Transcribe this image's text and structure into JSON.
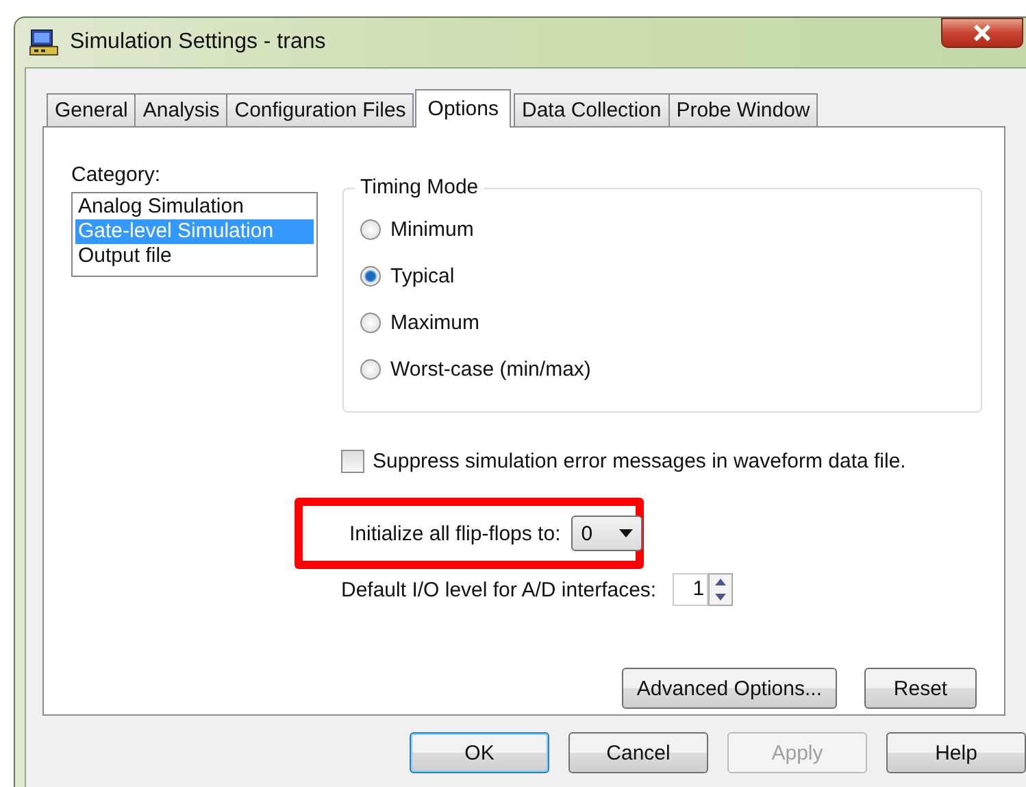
{
  "window": {
    "title": "Simulation Settings - trans"
  },
  "tabs": [
    {
      "label": "General",
      "selected": false
    },
    {
      "label": "Analysis",
      "selected": false
    },
    {
      "label": "Configuration Files",
      "selected": false
    },
    {
      "label": "Options",
      "selected": true
    },
    {
      "label": "Data Collection",
      "selected": false
    },
    {
      "label": "Probe Window",
      "selected": false
    }
  ],
  "category": {
    "label": "Category:",
    "items": [
      {
        "label": "Analog Simulation",
        "selected": false
      },
      {
        "label": "Gate-level Simulation",
        "selected": true
      },
      {
        "label": "Output file",
        "selected": false
      }
    ]
  },
  "timing_mode": {
    "title": "Timing Mode",
    "options": [
      {
        "label": "Minimum",
        "selected": false
      },
      {
        "label": "Typical",
        "selected": true
      },
      {
        "label": "Maximum",
        "selected": false
      },
      {
        "label": "Worst-case (min/max)",
        "selected": false
      }
    ]
  },
  "suppress_errors": {
    "label": "Suppress simulation error messages in waveform data file.",
    "checked": false
  },
  "init_flipflops": {
    "label": "Initialize all flip-flops to:",
    "value": "0",
    "highlighted": true
  },
  "default_io_level": {
    "label": "Default I/O level for A/D interfaces:",
    "value": "1"
  },
  "panel_buttons": [
    {
      "label": "Advanced Options..."
    },
    {
      "label": "Reset"
    }
  ],
  "dialog_buttons": [
    {
      "label": "OK",
      "default": true,
      "disabled": false
    },
    {
      "label": "Cancel",
      "default": false,
      "disabled": false
    },
    {
      "label": "Apply",
      "default": false,
      "disabled": true
    },
    {
      "label": "Help",
      "default": false,
      "disabled": false
    }
  ]
}
